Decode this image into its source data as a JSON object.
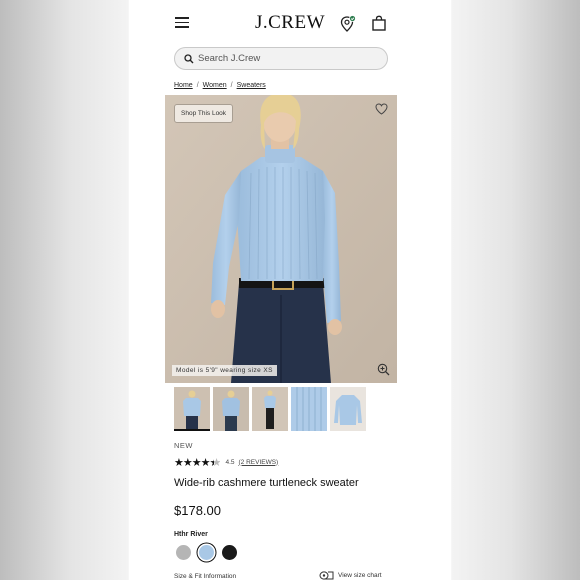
{
  "header": {
    "logo": "J.CREW",
    "menu_icon": "hamburger-menu-icon",
    "location_icon": "store-location-icon",
    "bag_icon": "shopping-bag-icon"
  },
  "search": {
    "placeholder": "Search J.Crew",
    "icon": "search-icon"
  },
  "breadcrumb": {
    "items": [
      "Home",
      "Women",
      "Sweaters"
    ],
    "separator": "/"
  },
  "gallery": {
    "shop_look_label": "Shop This Look",
    "model_note": "Model is 5'9\" wearing size XS",
    "wishlist_icon": "heart-icon",
    "zoom_icon": "zoom-in-icon",
    "thumbnail_count": 5,
    "active_thumbnail": 1
  },
  "product": {
    "badge": "NEW",
    "rating_value": "4.5",
    "rating_stars": 4.5,
    "reviews_label": "(2 REVIEWS)",
    "name": "Wide-rib cashmere turtleneck sweater",
    "price": "$178.00",
    "color_label": "Hthr River",
    "swatches": [
      {
        "name": "gray",
        "hex": "#b5b5b5",
        "selected": false
      },
      {
        "name": "Hthr River",
        "hex": "#a9c8e6",
        "selected": true
      },
      {
        "name": "black",
        "hex": "#1a1a1a",
        "selected": false
      }
    ],
    "size_fit_label": "Size & Fit Information",
    "size_chart_label": "View size chart"
  },
  "colors": {
    "sweater_blue": "#a9c8e6",
    "backdrop": "#cdc0b1",
    "denim": "#26324a"
  }
}
